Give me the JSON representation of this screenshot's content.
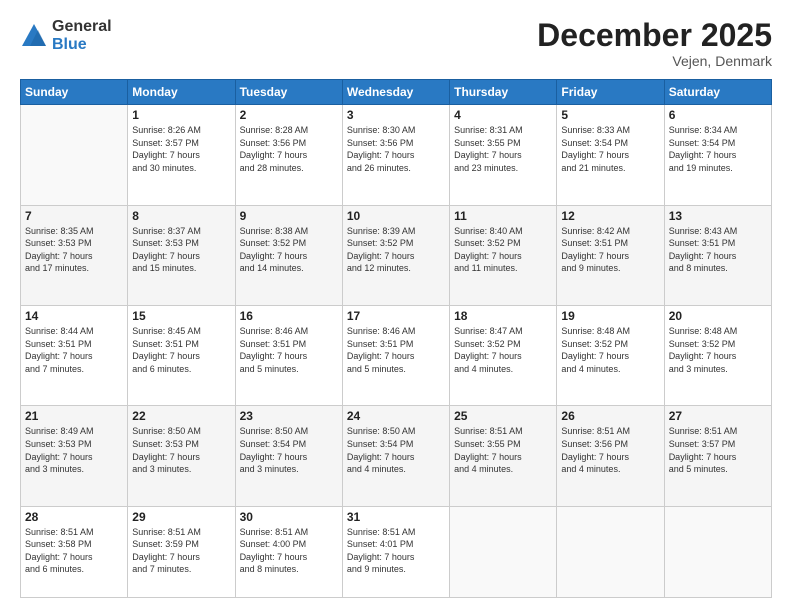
{
  "logo": {
    "general": "General",
    "blue": "Blue"
  },
  "header": {
    "month": "December 2025",
    "location": "Vejen, Denmark"
  },
  "weekdays": [
    "Sunday",
    "Monday",
    "Tuesday",
    "Wednesday",
    "Thursday",
    "Friday",
    "Saturday"
  ],
  "weeks": [
    [
      {
        "day": "",
        "sunrise": "",
        "sunset": "",
        "daylight": ""
      },
      {
        "day": "1",
        "sunrise": "Sunrise: 8:26 AM",
        "sunset": "Sunset: 3:57 PM",
        "daylight": "Daylight: 7 hours and 30 minutes."
      },
      {
        "day": "2",
        "sunrise": "Sunrise: 8:28 AM",
        "sunset": "Sunset: 3:56 PM",
        "daylight": "Daylight: 7 hours and 28 minutes."
      },
      {
        "day": "3",
        "sunrise": "Sunrise: 8:30 AM",
        "sunset": "Sunset: 3:56 PM",
        "daylight": "Daylight: 7 hours and 26 minutes."
      },
      {
        "day": "4",
        "sunrise": "Sunrise: 8:31 AM",
        "sunset": "Sunset: 3:55 PM",
        "daylight": "Daylight: 7 hours and 23 minutes."
      },
      {
        "day": "5",
        "sunrise": "Sunrise: 8:33 AM",
        "sunset": "Sunset: 3:54 PM",
        "daylight": "Daylight: 7 hours and 21 minutes."
      },
      {
        "day": "6",
        "sunrise": "Sunrise: 8:34 AM",
        "sunset": "Sunset: 3:54 PM",
        "daylight": "Daylight: 7 hours and 19 minutes."
      }
    ],
    [
      {
        "day": "7",
        "sunrise": "Sunrise: 8:35 AM",
        "sunset": "Sunset: 3:53 PM",
        "daylight": "Daylight: 7 hours and 17 minutes."
      },
      {
        "day": "8",
        "sunrise": "Sunrise: 8:37 AM",
        "sunset": "Sunset: 3:53 PM",
        "daylight": "Daylight: 7 hours and 15 minutes."
      },
      {
        "day": "9",
        "sunrise": "Sunrise: 8:38 AM",
        "sunset": "Sunset: 3:52 PM",
        "daylight": "Daylight: 7 hours and 14 minutes."
      },
      {
        "day": "10",
        "sunrise": "Sunrise: 8:39 AM",
        "sunset": "Sunset: 3:52 PM",
        "daylight": "Daylight: 7 hours and 12 minutes."
      },
      {
        "day": "11",
        "sunrise": "Sunrise: 8:40 AM",
        "sunset": "Sunset: 3:52 PM",
        "daylight": "Daylight: 7 hours and 11 minutes."
      },
      {
        "day": "12",
        "sunrise": "Sunrise: 8:42 AM",
        "sunset": "Sunset: 3:51 PM",
        "daylight": "Daylight: 7 hours and 9 minutes."
      },
      {
        "day": "13",
        "sunrise": "Sunrise: 8:43 AM",
        "sunset": "Sunset: 3:51 PM",
        "daylight": "Daylight: 7 hours and 8 minutes."
      }
    ],
    [
      {
        "day": "14",
        "sunrise": "Sunrise: 8:44 AM",
        "sunset": "Sunset: 3:51 PM",
        "daylight": "Daylight: 7 hours and 7 minutes."
      },
      {
        "day": "15",
        "sunrise": "Sunrise: 8:45 AM",
        "sunset": "Sunset: 3:51 PM",
        "daylight": "Daylight: 7 hours and 6 minutes."
      },
      {
        "day": "16",
        "sunrise": "Sunrise: 8:46 AM",
        "sunset": "Sunset: 3:51 PM",
        "daylight": "Daylight: 7 hours and 5 minutes."
      },
      {
        "day": "17",
        "sunrise": "Sunrise: 8:46 AM",
        "sunset": "Sunset: 3:51 PM",
        "daylight": "Daylight: 7 hours and 5 minutes."
      },
      {
        "day": "18",
        "sunrise": "Sunrise: 8:47 AM",
        "sunset": "Sunset: 3:52 PM",
        "daylight": "Daylight: 7 hours and 4 minutes."
      },
      {
        "day": "19",
        "sunrise": "Sunrise: 8:48 AM",
        "sunset": "Sunset: 3:52 PM",
        "daylight": "Daylight: 7 hours and 4 minutes."
      },
      {
        "day": "20",
        "sunrise": "Sunrise: 8:48 AM",
        "sunset": "Sunset: 3:52 PM",
        "daylight": "Daylight: 7 hours and 3 minutes."
      }
    ],
    [
      {
        "day": "21",
        "sunrise": "Sunrise: 8:49 AM",
        "sunset": "Sunset: 3:53 PM",
        "daylight": "Daylight: 7 hours and 3 minutes."
      },
      {
        "day": "22",
        "sunrise": "Sunrise: 8:50 AM",
        "sunset": "Sunset: 3:53 PM",
        "daylight": "Daylight: 7 hours and 3 minutes."
      },
      {
        "day": "23",
        "sunrise": "Sunrise: 8:50 AM",
        "sunset": "Sunset: 3:54 PM",
        "daylight": "Daylight: 7 hours and 3 minutes."
      },
      {
        "day": "24",
        "sunrise": "Sunrise: 8:50 AM",
        "sunset": "Sunset: 3:54 PM",
        "daylight": "Daylight: 7 hours and 4 minutes."
      },
      {
        "day": "25",
        "sunrise": "Sunrise: 8:51 AM",
        "sunset": "Sunset: 3:55 PM",
        "daylight": "Daylight: 7 hours and 4 minutes."
      },
      {
        "day": "26",
        "sunrise": "Sunrise: 8:51 AM",
        "sunset": "Sunset: 3:56 PM",
        "daylight": "Daylight: 7 hours and 4 minutes."
      },
      {
        "day": "27",
        "sunrise": "Sunrise: 8:51 AM",
        "sunset": "Sunset: 3:57 PM",
        "daylight": "Daylight: 7 hours and 5 minutes."
      }
    ],
    [
      {
        "day": "28",
        "sunrise": "Sunrise: 8:51 AM",
        "sunset": "Sunset: 3:58 PM",
        "daylight": "Daylight: 7 hours and 6 minutes."
      },
      {
        "day": "29",
        "sunrise": "Sunrise: 8:51 AM",
        "sunset": "Sunset: 3:59 PM",
        "daylight": "Daylight: 7 hours and 7 minutes."
      },
      {
        "day": "30",
        "sunrise": "Sunrise: 8:51 AM",
        "sunset": "Sunset: 4:00 PM",
        "daylight": "Daylight: 7 hours and 8 minutes."
      },
      {
        "day": "31",
        "sunrise": "Sunrise: 8:51 AM",
        "sunset": "Sunset: 4:01 PM",
        "daylight": "Daylight: 7 hours and 9 minutes."
      },
      {
        "day": "",
        "sunrise": "",
        "sunset": "",
        "daylight": ""
      },
      {
        "day": "",
        "sunrise": "",
        "sunset": "",
        "daylight": ""
      },
      {
        "day": "",
        "sunrise": "",
        "sunset": "",
        "daylight": ""
      }
    ]
  ]
}
